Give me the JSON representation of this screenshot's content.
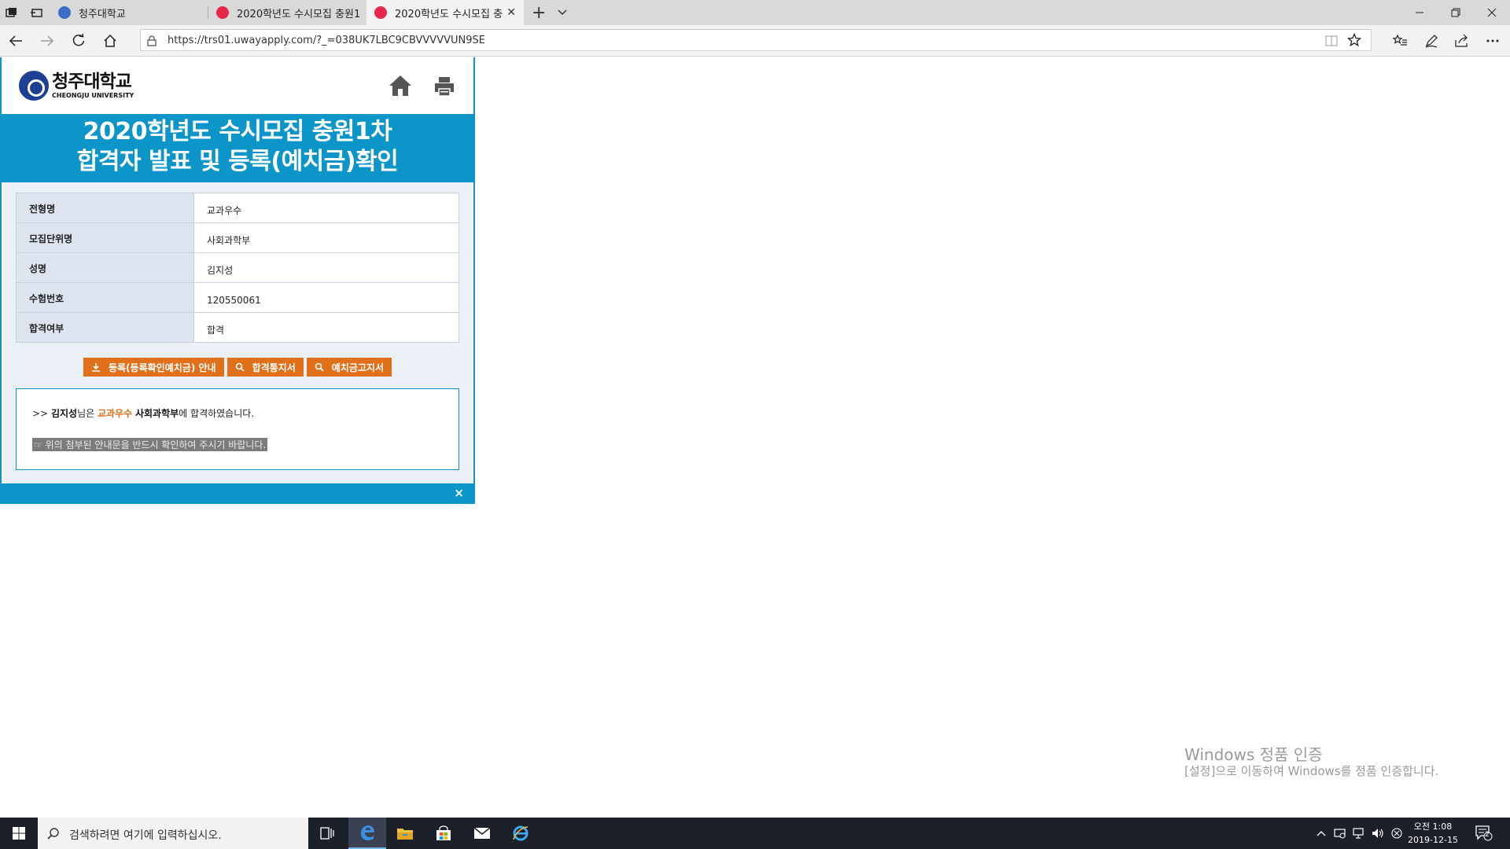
{
  "browser": {
    "tabs": [
      {
        "title": "청주대학교",
        "favicon_color": "#3b6dc7"
      },
      {
        "title": "2020학년도 수시모집 충원1",
        "favicon_color": "#e6274b"
      },
      {
        "title": "2020학년도 수시모집 충",
        "favicon_color": "#e6274b"
      }
    ],
    "url": "https://trs01.uwayapply.com/?_=038UK7LBC9CBVVVVVUN9SE"
  },
  "page": {
    "logo_kr": "청주대학교",
    "logo_en": "CHEONGJU UNIVERSITY",
    "title_line1": "2020학년도 수시모집 충원1차",
    "title_line2": "합격자 발표 및 등록(예치금)확인",
    "rows": [
      {
        "label": "전형명",
        "value": "교과우수"
      },
      {
        "label": "모집단위명",
        "value": "사회과학부"
      },
      {
        "label": "성명",
        "value": "김지성"
      },
      {
        "label": "수험번호",
        "value": "120550061"
      },
      {
        "label": "합격여부",
        "value": "합격"
      }
    ],
    "buttons": {
      "registration_guide": "등록(등록확인예치금) 안내",
      "acceptance_letter": "합격통지서",
      "deposit_notice": "예치금고지서"
    },
    "message": {
      "prefix": ">> ",
      "name": "김지성",
      "mid1": "님은 ",
      "track": "교과우수",
      "dept": "사회과학부",
      "suffix": "에 합격하였습니다.",
      "notice": "☞ 위의 첨부된 안내문을 반드시 확인하여 주시기 바랍니다."
    },
    "close_symbol": "×",
    "colors": {
      "primary": "#0b95c8",
      "accent": "#e1701b"
    }
  },
  "watermark": {
    "line1": "Windows 정품 인증",
    "line2": "[설정]으로 이동하여 Windows를 정품 인증합니다."
  },
  "taskbar": {
    "search_placeholder": "검색하려면 여기에 입력하십시오.",
    "time": "오전 1:08",
    "date": "2019-12-15",
    "notification_count": "2"
  }
}
